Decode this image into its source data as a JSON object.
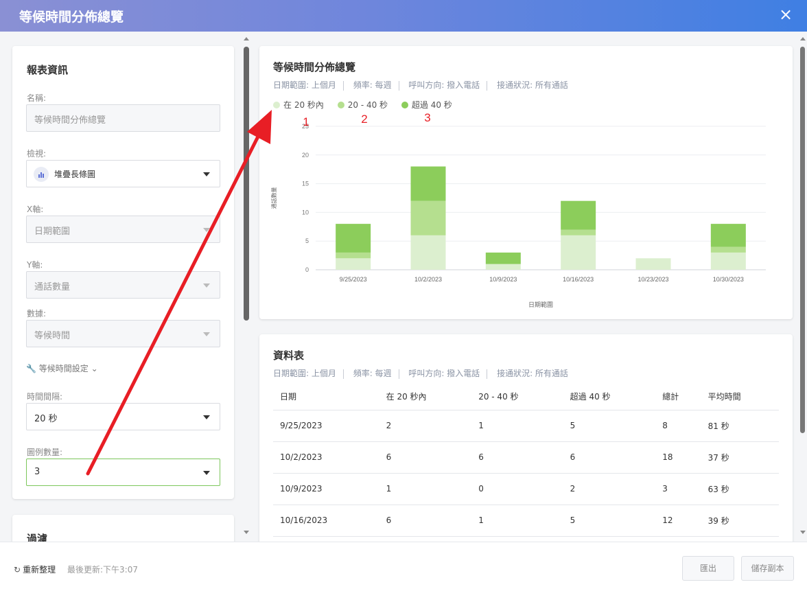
{
  "window": {
    "title": "等候時間分佈總覽",
    "close_icon": "×"
  },
  "report_info": {
    "title": "報表資訊",
    "name_label": "名稱:",
    "name_value": "等候時間分佈總覽",
    "view_label": "檢視:",
    "view_value": "堆疊長條圖",
    "x_label": "X軸:",
    "x_value": "日期範圍",
    "y_label": "Y軸:",
    "y_value": "通話數量",
    "data_label": "數據:",
    "data_value": "等候時間",
    "settings_link": "等候時間設定",
    "interval_label": "時間間隔:",
    "interval_value": "20 秒",
    "legend_count_label": "圖例數量:",
    "legend_count_value": "3"
  },
  "filter": {
    "title": "過濾"
  },
  "chart_card": {
    "title": "等候時間分佈總覽",
    "meta": [
      "日期範圍: 上個月",
      "頻率: 每週",
      "呼叫方向: 撥入電話",
      "接通狀況: 所有通話"
    ]
  },
  "annotations": {
    "numbers": [
      "1",
      "2",
      "3"
    ],
    "color": "#e81e25"
  },
  "chart_data": {
    "type": "bar",
    "stacked": true,
    "categories": [
      "9/25/2023",
      "10/2/2023",
      "10/9/2023",
      "10/16/2023",
      "10/23/2023",
      "10/30/2023"
    ],
    "series": [
      {
        "name": "在 20 秒內",
        "color": "#dcefcf",
        "values": [
          2,
          6,
          1,
          6,
          2,
          3
        ]
      },
      {
        "name": "20 - 40 秒",
        "color": "#b5df8f",
        "values": [
          1,
          6,
          0,
          1,
          0,
          1
        ]
      },
      {
        "name": "超過 40 秒",
        "color": "#8ccd5b",
        "values": [
          5,
          6,
          2,
          5,
          0,
          4
        ]
      }
    ],
    "y_ticks": [
      "0",
      "5",
      "10",
      "15",
      "20",
      "25"
    ],
    "ylim": [
      0,
      25
    ],
    "ylabel": "通話數量",
    "xlabel": "日期範圍",
    "grid": true,
    "legend_position": "top-left"
  },
  "table_card": {
    "title": "資料表",
    "meta": [
      "日期範圍: 上個月",
      "頻率: 每週",
      "呼叫方向: 撥入電話",
      "接通狀況: 所有通話"
    ],
    "columns": [
      "日期",
      "在 20 秒內",
      "20 - 40 秒",
      "超過 40 秒",
      "總計",
      "平均時間"
    ],
    "rows": [
      [
        "9/25/2023",
        "2",
        "1",
        "5",
        "8",
        "81 秒"
      ],
      [
        "10/2/2023",
        "6",
        "6",
        "6",
        "18",
        "37 秒"
      ],
      [
        "10/9/2023",
        "1",
        "0",
        "2",
        "3",
        "63 秒"
      ],
      [
        "10/16/2023",
        "6",
        "1",
        "5",
        "12",
        "39 秒"
      ]
    ]
  },
  "footer": {
    "refresh_label": "重新整理",
    "refresh_icon": "↻",
    "last_updated": "最後更新:下午3:07",
    "export_label": "匯出",
    "save_copy_label": "儲存副本"
  }
}
